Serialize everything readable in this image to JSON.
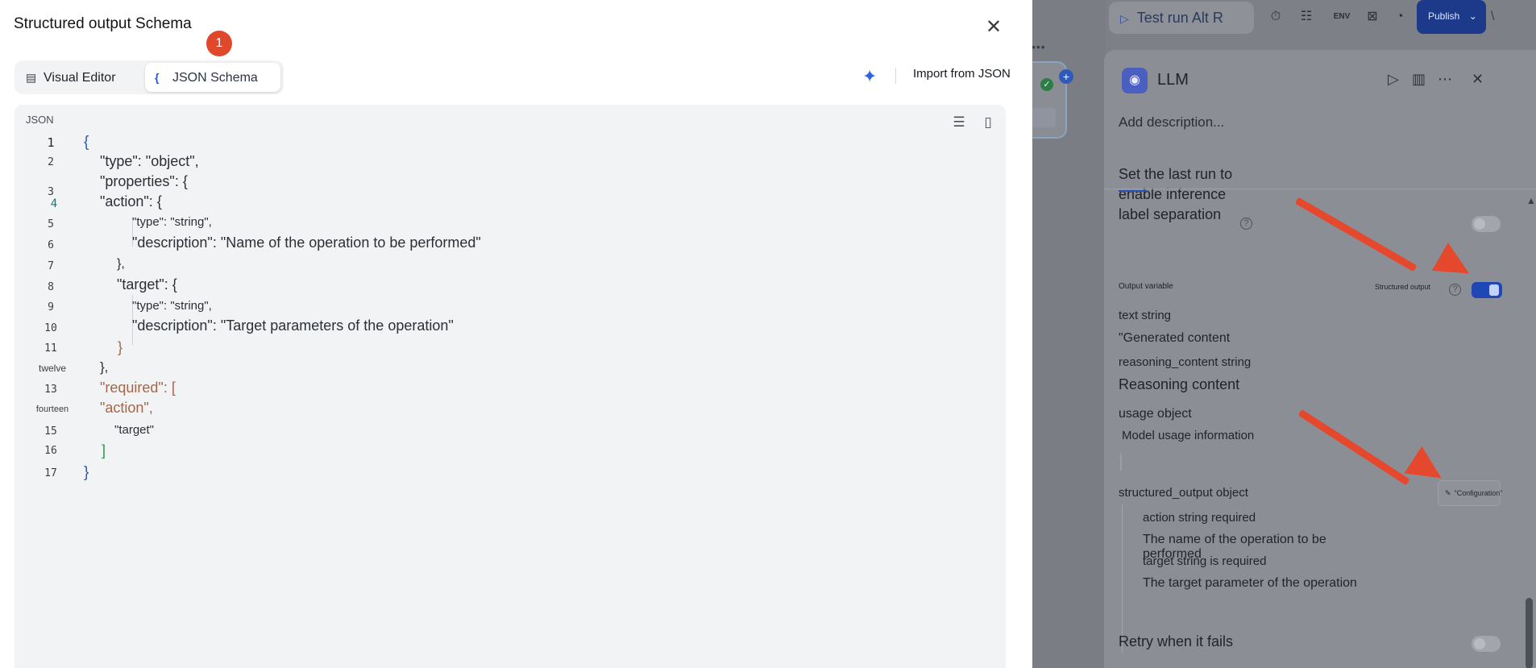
{
  "background": {
    "toolbar": {
      "test_run": "Test run Alt R",
      "publish": "Publish"
    },
    "panel": {
      "title": "LLM",
      "add_description": "Add description...",
      "last_run_note": "Set the last run to enable inference label separation",
      "output_variable_label": "Output variable",
      "structured_output_label": "Structured output",
      "outputs": [
        {
          "text": "text string"
        },
        {
          "text": "\"Generated content"
        },
        {
          "text": "reasoning_content string"
        },
        {
          "text": "Reasoning content"
        },
        {
          "text": "usage object"
        },
        {
          "text": "Model usage information"
        },
        {
          "text": "structured_output object"
        }
      ],
      "configuration_button": "\"Configuration\"",
      "structured_children": [
        {
          "text": "action string required"
        },
        {
          "text": "The name of the operation to be performed"
        },
        {
          "text": "target string is required"
        },
        {
          "text": "The target parameter of the operation"
        }
      ],
      "retry_label": "Retry when it fails"
    }
  },
  "modal": {
    "title": "Structured output Schema",
    "badge": "1",
    "tabs": [
      {
        "label": "Visual Editor",
        "icon": "document-icon",
        "active": false
      },
      {
        "label": "JSON Schema",
        "icon": "brace-icon",
        "active": true
      }
    ],
    "import_button": "Import from JSON",
    "editor_label": "JSON",
    "line_numbers": [
      "1",
      "2",
      "3",
      "4",
      "5",
      "6",
      "7",
      "8",
      "9",
      "10",
      "11",
      "twelve",
      "13",
      "fourteen",
      "15",
      "16",
      "17"
    ],
    "code": {
      "l1": "{",
      "l2": "\"type\": \"object\",",
      "l3": "\"properties\": {",
      "l4": "\"action\": {",
      "l5": "\"type\": \"string\",",
      "l6": "\"description\": \"Name of the operation to be performed\"",
      "l7": "},",
      "l8": "\"target\": {",
      "l9": "\"type\": \"string\",",
      "l10": "\"description\": \"Target parameters of the operation\"",
      "l11": "}",
      "l12": "},",
      "l13": "\"required\": [",
      "l14": "\"action\",",
      "l15": "\"target\"",
      "l16": "]",
      "l17": "}"
    }
  }
}
